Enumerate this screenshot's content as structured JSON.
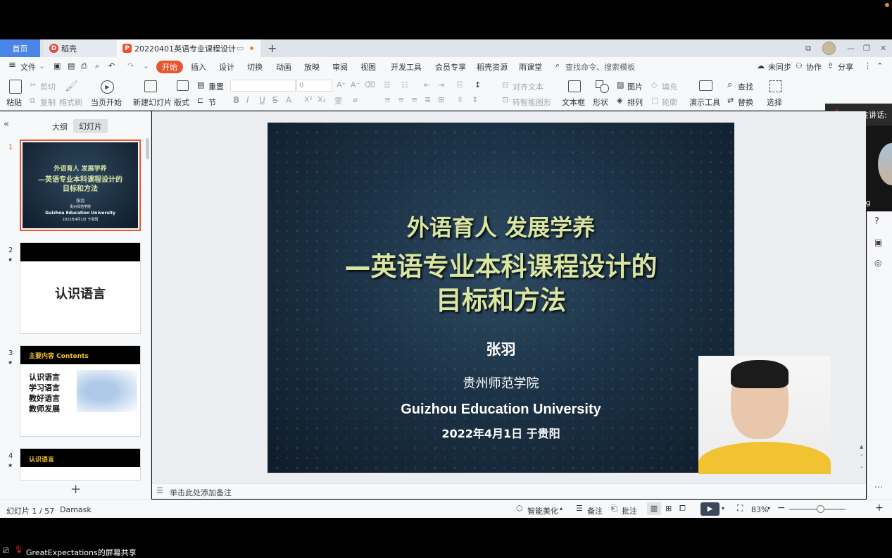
{
  "tabs": {
    "home": "首页",
    "daoke": "稻壳",
    "doc": "20220401英语专业课程设计",
    "new_tab": "+"
  },
  "menu": {
    "file": "文件",
    "items": [
      "开始",
      "插入",
      "设计",
      "切换",
      "动画",
      "放映",
      "审阅",
      "视图",
      "开发工具",
      "会员专享",
      "稻壳资源",
      "雨课堂"
    ],
    "search_placeholder": "查找命令、搜索模板",
    "unsynced": "未同步",
    "collab": "协作",
    "share": "分享"
  },
  "ribbon": {
    "paste": "粘贴",
    "cut": "剪切",
    "copy": "复制",
    "format_painter": "格式刷",
    "from_current": "当页开始",
    "new_slide": "新建幻灯片",
    "layout": "版式",
    "reset": "重置",
    "section": "节",
    "font_size": "0",
    "align_text": "对齐文本",
    "smart_art": "转智能图形",
    "textbox": "文本框",
    "shape": "形状",
    "picture": "图片",
    "arrange": "排列",
    "fill": "填充",
    "outline": "轮廓",
    "presenter": "演示工具",
    "find": "查找",
    "replace": "替换",
    "select": "选择"
  },
  "panel": {
    "outline_tab": "大纲",
    "slides_tab": "幻灯片",
    "add": "+"
  },
  "thumbs": [
    {
      "num": "1",
      "line1": "外语育人  发展学养",
      "line2": "—英语专业本科课程设计的",
      "line3": "目标和方法",
      "author": "张羽",
      "school": "贵州师范学院",
      "school_en": "Guizhou Education University",
      "date": "2022年4月1日 于贵阳"
    },
    {
      "num": "2",
      "title": "认识语言"
    },
    {
      "num": "3",
      "header": "主要内容 Contents",
      "items": [
        "认识语言",
        "学习语言",
        "教好语言",
        "教师发展"
      ]
    },
    {
      "num": "4",
      "header": "认识语言"
    }
  ],
  "slide": {
    "line1": "外语育人   发展学养",
    "line2": "—英语专业本科课程设计的",
    "line3": "目标和方法",
    "author": "张羽",
    "school": "贵州师范学院",
    "school_en": "Guizhou Education University",
    "date": "2022年4月1日 于贵阳"
  },
  "notes_placeholder": "单击此处添加备注",
  "status": {
    "slide_count": "幻灯片 1 / 57",
    "theme": "Damask",
    "beautify": "智能美化",
    "notes": "备注",
    "comments": "批注",
    "zoom": "83%",
    "zoom_level": 0.55
  },
  "speaker": {
    "speaking": "正在讲话:",
    "name": "feibeing"
  },
  "share_bar": {
    "label": "GreatExpectations的屏幕共享"
  },
  "colors": {
    "accent": "#e8552f",
    "home_tab": "#4a84e6",
    "slide_title": "#d9e6a2",
    "daoke_logo": "#e34a3a"
  }
}
